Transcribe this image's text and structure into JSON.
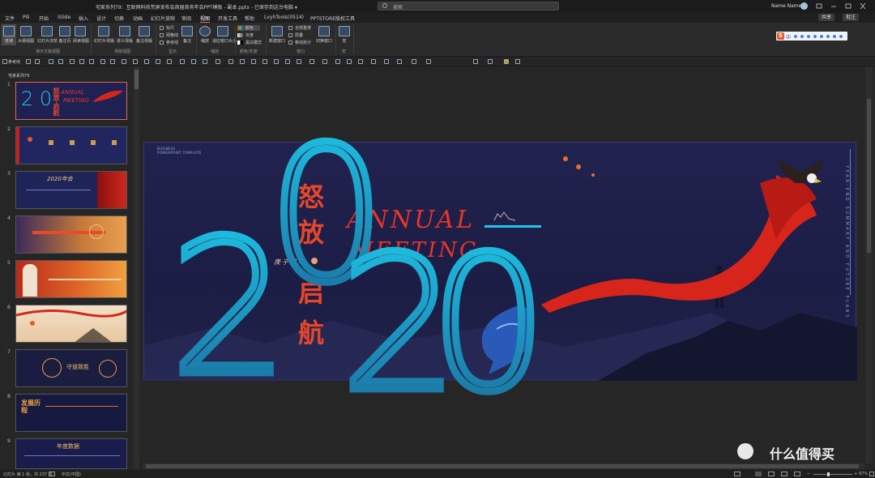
{
  "titlebar": {
    "title": "宅家系列79：互联网科技荒屏发布会商届商务年会PPT模板 - 副本.pptx  -  已保存到这台电脑 ▾",
    "search_placeholder": "搜索",
    "user": "Name Name"
  },
  "menu": {
    "tabs": [
      "文件",
      "Pili",
      "开始",
      "iSlide",
      "插入",
      "设计",
      "切换",
      "动画",
      "幻灯片放映",
      "审阅",
      "视图",
      "开发工具",
      "帮助",
      "LvyhTools(0514)",
      "PPTSTORE版权工具"
    ],
    "active": "视图",
    "share": "共享",
    "comments": "批注"
  },
  "ribbon": {
    "presentation_views": [
      "普通",
      "大纲视图",
      "幻灯片浏览",
      "备注页",
      "阅读视图"
    ],
    "presentation_views_group": "演示文稿视图",
    "master_views": [
      "幻灯片母版",
      "讲义母版",
      "备注母版"
    ],
    "master_views_group": "母版视图",
    "show": [
      "标尺",
      "网格线",
      "参考线"
    ],
    "show_extra": "备注",
    "show_group": "显示",
    "zoom": [
      "缩放",
      "适应窗口大小"
    ],
    "zoom_group": "缩放",
    "color": [
      "颜色",
      "灰度",
      "黑白模式"
    ],
    "color_group": "颜色/灰度",
    "window": [
      "新建窗口",
      "全部重排",
      "层叠",
      "移动拆分",
      "切换窗口"
    ],
    "window_group": "窗口",
    "macro": "宏",
    "macro_group": "宏",
    "ime": {
      "logo": "S",
      "mode": "中"
    }
  },
  "qat": {
    "label": "参考线"
  },
  "panel": {
    "section": "宅家系列79",
    "slide_numbers": [
      "1",
      "2",
      "3",
      "4",
      "5",
      "6",
      "7",
      "8",
      "9"
    ],
    "thumb_texts": {
      "s1_cn": "怒放·启航",
      "s3": "2020年会",
      "s7": "守道致胜",
      "s8": "发展历程",
      "s9": "年度数据"
    }
  },
  "slide": {
    "biz_line1": "BUSINESS",
    "biz_line2": "POWERPOINT TEMPLATE",
    "year_digits": [
      "2",
      "0",
      "2",
      "0"
    ],
    "annual": "ANNUAL",
    "meeting": "MEETING",
    "cn_top": [
      "怒",
      "放"
    ],
    "cn_bottom": [
      "启",
      "航"
    ],
    "cn_sub": "庚子鼠年",
    "vertical_text": "YEAR-END SUMMARY AND FUTURE PLANS"
  },
  "status": {
    "slide_info": "幻灯片 第 1 张，共 237 张",
    "lang": "中文(中国)",
    "zoom": "97%"
  },
  "watermark": {
    "text": "什么值得买"
  },
  "colors": {
    "accent": "#e06a4a",
    "cyan": "#1ec7e8",
    "red": "#e8352a",
    "slide_bg": "#1e2048"
  }
}
